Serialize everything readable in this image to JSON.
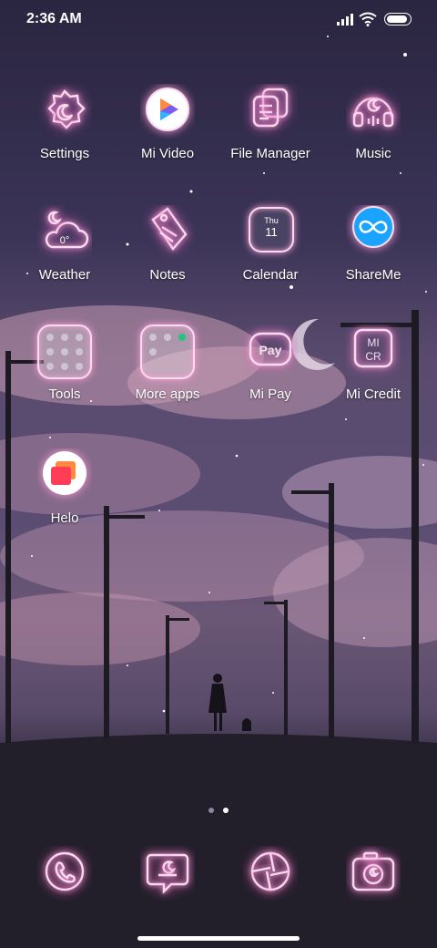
{
  "status": {
    "time": "2:36 AM"
  },
  "apps": [
    {
      "label": "Settings"
    },
    {
      "label": "Mi Video"
    },
    {
      "label": "File Manager"
    },
    {
      "label": "Music"
    },
    {
      "label": "Weather",
      "temp": "0°"
    },
    {
      "label": "Notes"
    },
    {
      "label": "Calendar",
      "day": "Thu",
      "date": "11"
    },
    {
      "label": "ShareMe"
    },
    {
      "label": "Tools"
    },
    {
      "label": "More apps"
    },
    {
      "label": "Mi Pay",
      "glyph": "Pay"
    },
    {
      "label": "Mi Credit",
      "glyph1": "MI",
      "glyph2": "CR"
    },
    {
      "label": "Helo"
    }
  ],
  "page_indicator": {
    "pages": 2,
    "current": 2
  },
  "dock": [
    {
      "icon": "phone-icon"
    },
    {
      "icon": "messages-icon"
    },
    {
      "icon": "browser-icon"
    },
    {
      "icon": "camera-icon"
    }
  ]
}
